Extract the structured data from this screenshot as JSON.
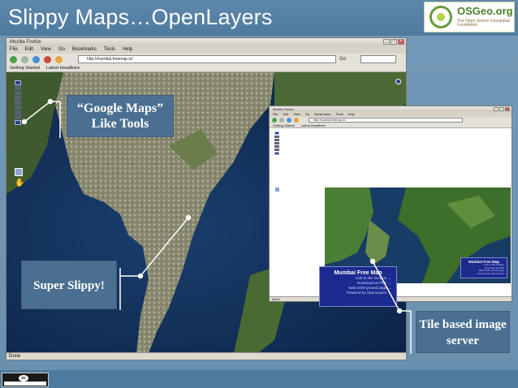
{
  "slide": {
    "title": "Slippy Maps…OpenLayers",
    "logo": {
      "name": "OSGeo.org",
      "tagline": "The Open Source Geospatial Foundation"
    }
  },
  "browser_main": {
    "window_title": "Mozilla Firefox",
    "menu": [
      "File",
      "Edit",
      "View",
      "Go",
      "Bookmarks",
      "Tools",
      "Help"
    ],
    "url": "http://mumbai.freemap.in/",
    "go_label": "Go",
    "bookmarks": [
      "Getting Started",
      "Latest Headlines"
    ],
    "status": "Done",
    "panel": {
      "title": "Mumbai Free Map",
      "lines": [
        "Link to this location →",
        "Download as PDF →",
        "Wait OSM ground page →",
        "Powered by OpenLayers →"
      ]
    }
  },
  "browser_second": {
    "window_title": "Mozilla Firefox",
    "menu": [
      "File",
      "Edit",
      "View",
      "Go",
      "Bookmarks",
      "Tools",
      "Help"
    ],
    "url": "http://mumbai.freemap.in/",
    "bookmarks": [
      "Getting Started",
      "Latest Headlines"
    ],
    "status": "Done",
    "panel": {
      "title": "Mumbai Free Map",
      "lines": [
        "Link to this location",
        "Download as PDF",
        "Wait OSM ground page",
        "Powered by OpenLayers"
      ]
    }
  },
  "callouts": {
    "google_maps_tools": "“Google Maps” Like Tools",
    "super_slippy": "Super Slippy!",
    "tile_based": "Tile based image server"
  },
  "colors": {
    "slide_bg": "#6f96b6",
    "callout_bg": "#4a6f90",
    "map_panel": "#1b2a8e",
    "osgeo_green": "#4a7f2b"
  },
  "icons": {
    "pan_hand": "hand-icon",
    "layer_switcher": "layers-icon",
    "license": "creative-commons-icon"
  }
}
